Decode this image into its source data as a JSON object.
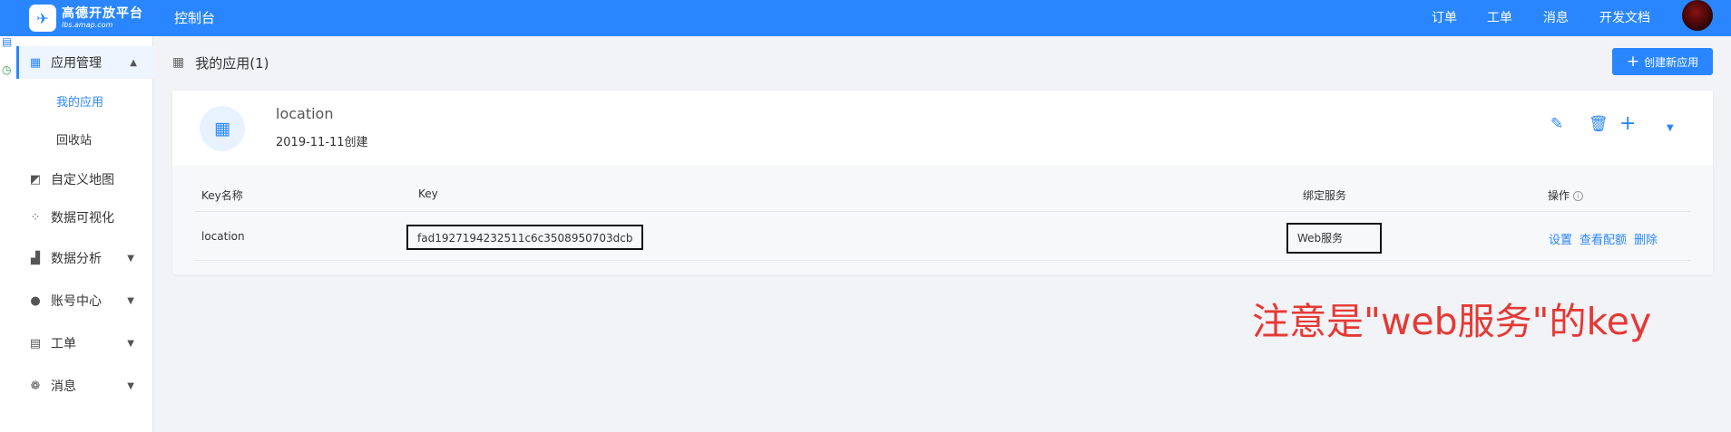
{
  "header": {
    "logo_text": "高德开放平台",
    "logo_sub": "lbs.amap.com",
    "console": "控制台",
    "nav": [
      "订单",
      "工单",
      "消息",
      "开发文档"
    ]
  },
  "sidebar": {
    "items": [
      {
        "label": "应用管理",
        "icon": "grid-icon"
      },
      {
        "label": "自定义地图",
        "icon": "map-edit-icon"
      },
      {
        "label": "数据可视化",
        "icon": "data-viz-icon"
      },
      {
        "label": "数据分析",
        "icon": "bar-chart-icon"
      },
      {
        "label": "账号中心",
        "icon": "user-icon"
      },
      {
        "label": "工单",
        "icon": "clipboard-icon"
      },
      {
        "label": "消息",
        "icon": "chat-icon"
      }
    ],
    "subitems": [
      "我的应用",
      "回收站"
    ]
  },
  "page": {
    "title": "我的应用(1)",
    "create_button": "创建新应用"
  },
  "app": {
    "name": "location",
    "created": "2019-11-11创建"
  },
  "table": {
    "headers": {
      "keyname": "Key名称",
      "key": "Key",
      "service": "绑定服务",
      "ops": "操作"
    },
    "row": {
      "name": "location",
      "key": "fad1927194232511c6c3508950703dcb",
      "service": "Web服务",
      "ops": [
        "设置",
        "查看配额",
        "删除"
      ]
    }
  },
  "annotation": "注意是\"web服务\"的key",
  "colors": {
    "primary": "#2a86ff",
    "annotation": "#e53935"
  }
}
